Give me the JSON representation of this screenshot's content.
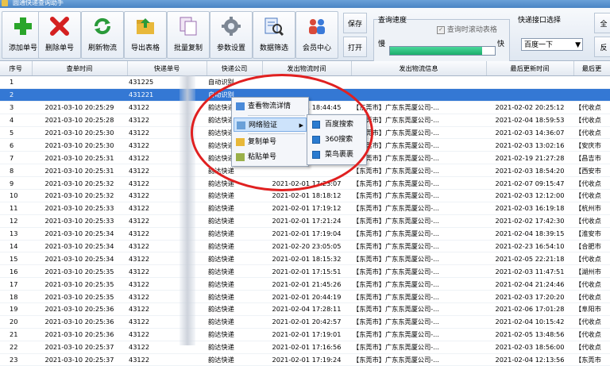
{
  "window": {
    "title": "圆通快递查询助手"
  },
  "toolbar": {
    "buttons": [
      {
        "label": "添加单号",
        "icon": "plus-icon"
      },
      {
        "label": "删除单号",
        "icon": "red-x-icon"
      },
      {
        "label": "刷新物流",
        "icon": "refresh-icon"
      },
      {
        "label": "导出表格",
        "icon": "folder-export-icon"
      },
      {
        "label": "批量复制",
        "icon": "copy-icon"
      },
      {
        "label": "参数设置",
        "icon": "gear-icon"
      },
      {
        "label": "数据筛选",
        "icon": "filter-icon"
      },
      {
        "label": "会员中心",
        "icon": "member-icon"
      }
    ],
    "save_label": "保存",
    "open_label": "打开",
    "speed_label": "查询速度",
    "scroll_label": "查询时滚动表格",
    "slow_label": "慢",
    "fast_label": "快",
    "speed_level": 0.88,
    "api_label": "快递接口选择",
    "api_selected": "百度一下",
    "all_label": "全",
    "reverse_label": "反"
  },
  "table": {
    "headers": [
      "序号",
      "查单时间",
      "快递单号",
      "快递公司",
      "发出物流时间",
      "发出物流信息",
      "最后更新时间",
      "最后更"
    ],
    "rows": [
      {
        "no": "1",
        "time": "",
        "num": "431225",
        "company": "自动识别",
        "send": "",
        "info": "",
        "last": "",
        "lastinfo": ""
      },
      {
        "no": "2",
        "time": "",
        "num": "431221",
        "company": "自动识别",
        "send": "",
        "info": "",
        "last": "",
        "lastinfo": ""
      },
      {
        "no": "3",
        "time": "2021-03-10 20:25:29",
        "num": "43122",
        "company": "韵达快递",
        "send": "2021-02-01 18:44:45",
        "info": "【东莞市】广东东莞厦公司-...",
        "last": "2021-02-02 20:25:12",
        "lastinfo": "【代收点"
      },
      {
        "no": "4",
        "time": "2021-03-10 20:25:28",
        "num": "43122",
        "company": "韵达快递",
        "send": "",
        "info": "【东莞市】广东东莞厦公司-...",
        "last": "2021-02-04 18:59:53",
        "lastinfo": "【代收点"
      },
      {
        "no": "5",
        "time": "2021-03-10 20:25:30",
        "num": "43122",
        "company": "韵达快递",
        "send": "",
        "info": "【东莞市】广东东莞厦公司-...",
        "last": "2021-02-03 14:36:07",
        "lastinfo": "【代收点"
      },
      {
        "no": "6",
        "time": "2021-03-10 20:25:30",
        "num": "43122",
        "company": "韵达快递",
        "send": "",
        "info": "【东莞市】广东东莞厦公司-...",
        "last": "2021-02-03 13:02:16",
        "lastinfo": "【安庆市"
      },
      {
        "no": "7",
        "time": "2021-03-10 20:25:31",
        "num": "43122",
        "company": "韵达快递",
        "send": "",
        "info": "【东莞市】广东东莞厦公司-...",
        "last": "2021-02-19 21:27:28",
        "lastinfo": "【昌吉市"
      },
      {
        "no": "8",
        "time": "2021-03-10 20:25:31",
        "num": "43122",
        "company": "韵达快递",
        "send": "",
        "info": "【东莞市】广东东莞厦公司-...",
        "last": "2021-02-03 18:54:20",
        "lastinfo": "【西安市"
      },
      {
        "no": "9",
        "time": "2021-03-10 20:25:32",
        "num": "43122",
        "company": "韵达快递",
        "send": "2021-02-01 17:23:07",
        "info": "【东莞市】广东东莞厦公司-...",
        "last": "2021-02-07 09:15:47",
        "lastinfo": "【代收点"
      },
      {
        "no": "10",
        "time": "2021-03-10 20:25:32",
        "num": "43122",
        "company": "韵达快递",
        "send": "2021-02-01 18:18:12",
        "info": "【东莞市】广东东莞厦公司-...",
        "last": "2021-02-03 12:12:00",
        "lastinfo": "【代收点"
      },
      {
        "no": "11",
        "time": "2021-03-10 20:25:33",
        "num": "43122",
        "company": "韵达快递",
        "send": "2021-02-01 17:19:12",
        "info": "【东莞市】广东东莞厦公司-...",
        "last": "2021-02-03 16:19:18",
        "lastinfo": "【杭州市"
      },
      {
        "no": "12",
        "time": "2021-03-10 20:25:33",
        "num": "43122",
        "company": "韵达快递",
        "send": "2021-02-01 17:21:24",
        "info": "【东莞市】广东东莞厦公司-...",
        "last": "2021-02-02 17:42:30",
        "lastinfo": "【代收点"
      },
      {
        "no": "13",
        "time": "2021-03-10 20:25:34",
        "num": "43122",
        "company": "韵达快递",
        "send": "2021-02-01 17:19:04",
        "info": "【东莞市】广东东莞厦公司-...",
        "last": "2021-02-04 18:39:15",
        "lastinfo": "【淮安市"
      },
      {
        "no": "14",
        "time": "2021-03-10 20:25:34",
        "num": "43122",
        "company": "韵达快递",
        "send": "2021-02-20 23:05:05",
        "info": "【东莞市】广东东莞厦公司-...",
        "last": "2021-02-23 16:54:10",
        "lastinfo": "【合肥市"
      },
      {
        "no": "15",
        "time": "2021-03-10 20:25:34",
        "num": "43122",
        "company": "韵达快递",
        "send": "2021-02-01 18:15:32",
        "info": "【东莞市】广东东莞厦公司-...",
        "last": "2021-02-05 22:21:18",
        "lastinfo": "【代收点"
      },
      {
        "no": "16",
        "time": "2021-03-10 20:25:35",
        "num": "43122",
        "company": "韵达快递",
        "send": "2021-02-01 17:15:51",
        "info": "【东莞市】广东东莞厦公司-...",
        "last": "2021-02-03 11:47:51",
        "lastinfo": "【湖州市"
      },
      {
        "no": "17",
        "time": "2021-03-10 20:25:35",
        "num": "43122",
        "company": "韵达快递",
        "send": "2021-02-01 21:45:26",
        "info": "【东莞市】广东东莞厦公司-...",
        "last": "2021-02-04 21:24:46",
        "lastinfo": "【代收点"
      },
      {
        "no": "18",
        "time": "2021-03-10 20:25:35",
        "num": "43122",
        "company": "韵达快递",
        "send": "2021-02-01 20:44:19",
        "info": "【东莞市】广东东莞厦公司-...",
        "last": "2021-02-03 17:20:20",
        "lastinfo": "【代收点"
      },
      {
        "no": "19",
        "time": "2021-03-10 20:25:36",
        "num": "43122",
        "company": "韵达快递",
        "send": "2021-02-04 17:28:11",
        "info": "【东莞市】广东东莞厦公司-...",
        "last": "2021-02-06 17:01:28",
        "lastinfo": "【阜阳市"
      },
      {
        "no": "20",
        "time": "2021-03-10 20:25:36",
        "num": "43122",
        "company": "韵达快递",
        "send": "2021-02-01 20:42:57",
        "info": "【东莞市】广东东莞厦公司-...",
        "last": "2021-02-04 10:15:42",
        "lastinfo": "【代收点"
      },
      {
        "no": "21",
        "time": "2021-03-10 20:25:36",
        "num": "43122",
        "company": "韵达快递",
        "send": "2021-02-01 17:19:01",
        "info": "【东莞市】广东东莞厦公司-...",
        "last": "2021-02-05 13:48:56",
        "lastinfo": "【代收点"
      },
      {
        "no": "22",
        "time": "2021-03-10 20:25:37",
        "num": "43122",
        "company": "韵达快递",
        "send": "2021-02-01 17:16:56",
        "info": "【东莞市】广东东莞厦公司-...",
        "last": "2021-02-03 18:56:00",
        "lastinfo": "【代收点"
      },
      {
        "no": "23",
        "time": "2021-03-10 20:25:37",
        "num": "43122",
        "company": "韵达快递",
        "send": "2021-02-01 17:19:24",
        "info": "【东莞市】广东东莞厦公司-...",
        "last": "2021-02-04 12:13:56",
        "lastinfo": "【东莞市"
      }
    ]
  },
  "context_menu": {
    "items": [
      "查看物流详情",
      "网络验证",
      "复制单号",
      "粘贴单号"
    ],
    "submenu": [
      "百度搜索",
      "360搜索",
      "菜鸟裹裹"
    ]
  },
  "colors": {
    "selection": "#3478d4",
    "annotation_ring": "#e02020",
    "progress": "#1cae6b"
  }
}
